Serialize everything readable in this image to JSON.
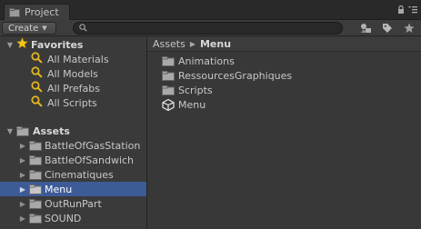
{
  "window": {
    "tab_title": "Project"
  },
  "toolbar": {
    "create_label": "Create",
    "search_placeholder": ""
  },
  "favorites": {
    "label": "Favorites",
    "items": [
      {
        "label": "All Materials"
      },
      {
        "label": "All Models"
      },
      {
        "label": "All Prefabs"
      },
      {
        "label": "All Scripts"
      }
    ]
  },
  "assets": {
    "label": "Assets",
    "folders": [
      {
        "label": "BattleOfGasStation",
        "selected": false
      },
      {
        "label": "BattleOfSandwich",
        "selected": false
      },
      {
        "label": "Cinematiques",
        "selected": false
      },
      {
        "label": "Menu",
        "selected": true
      },
      {
        "label": "OutRunPart",
        "selected": false
      },
      {
        "label": "SOUND",
        "selected": false
      }
    ]
  },
  "breadcrumb": {
    "root": "Assets",
    "current": "Menu"
  },
  "content": {
    "items": [
      {
        "label": "Animations",
        "icon": "folder-icon"
      },
      {
        "label": "RessourcesGraphiques",
        "icon": "folder-icon"
      },
      {
        "label": "Scripts",
        "icon": "folder-icon"
      },
      {
        "label": "Menu",
        "icon": "unity-scene-icon"
      }
    ]
  },
  "colors": {
    "selection": "#3d5b96",
    "panel": "#383838",
    "star": "#f2c31a",
    "search_icon": "#e6b81e"
  }
}
